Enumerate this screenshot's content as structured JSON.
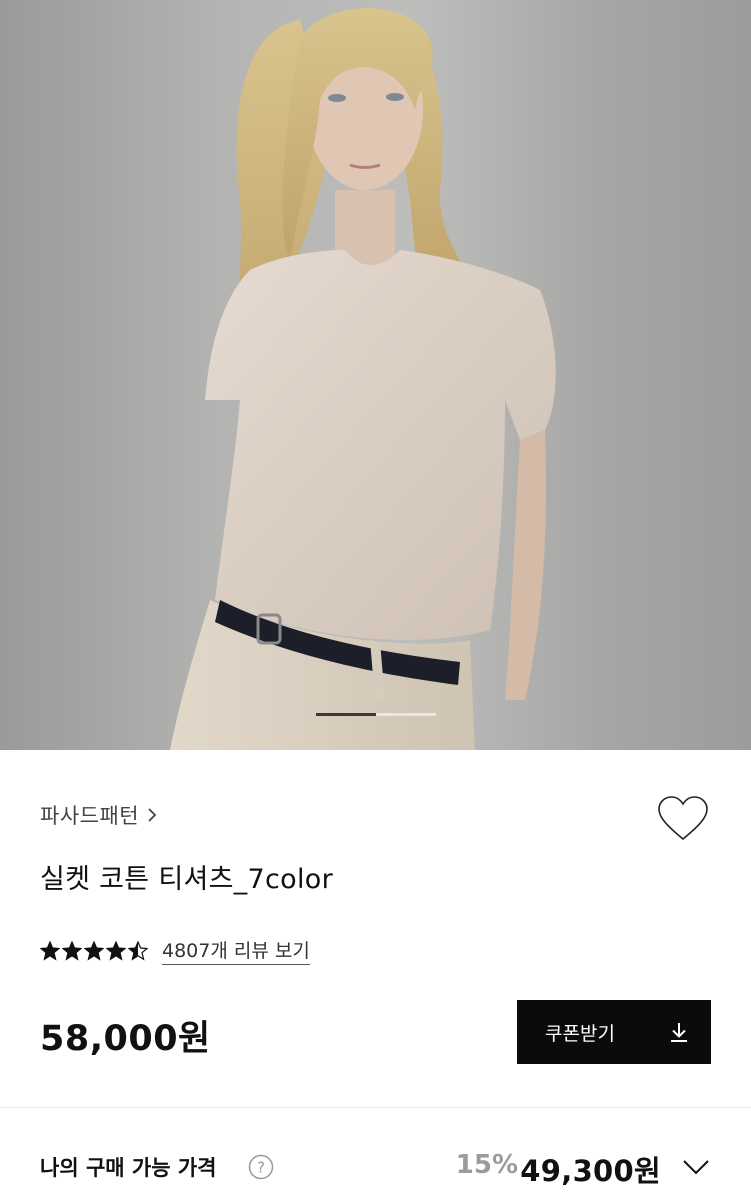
{
  "product": {
    "brand": "파사드패턴",
    "title": "실켓 코튼 티셔츠_7color",
    "review_link": "4807개 리뷰 보기",
    "rating": 4.5,
    "price": "58,000원",
    "coupon_button": "쿠폰받기"
  },
  "carousel": {
    "progress": 0.5
  },
  "my_price": {
    "label": "나의 구매 가능 가격",
    "discount": "15%",
    "final_price": "49,300원"
  },
  "icons": {
    "brand_chevron": "chevron-right-icon",
    "wish": "heart-outline-icon",
    "help": "question-circle-icon",
    "coupon": "download-icon",
    "expand": "chevron-down-icon"
  },
  "colors": {
    "button_bg": "#0b0b0b",
    "discount_text": "#9b9b9b",
    "star": "#111111"
  }
}
